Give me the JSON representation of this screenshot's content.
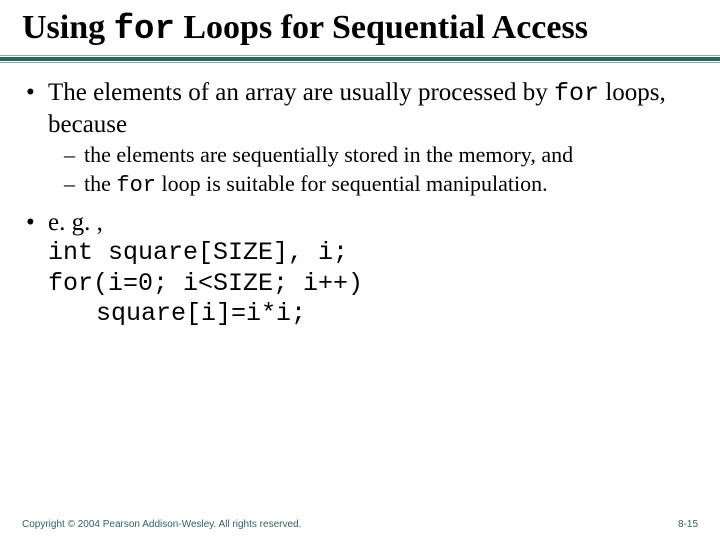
{
  "title": {
    "pre": "Using ",
    "code": "for",
    "post": " Loops for Sequential Access"
  },
  "bullets": {
    "b1_pre": "The elements of an array are usually processed by ",
    "b1_code": "for",
    "b1_post": " loops, because",
    "sub1": "the elements are sequentially stored in the memory, and",
    "sub2_pre": "the ",
    "sub2_code": "for",
    "sub2_post": " loop is suitable for sequential manipulation.",
    "b2": "e. g. ,",
    "code1": "int square[SIZE], i;",
    "code2": "for(i=0; i<SIZE; i++)",
    "code3": "square[i]=i*i;"
  },
  "footer": {
    "copyright": "Copyright © 2004 Pearson Addison-Wesley. All rights reserved.",
    "pagenum": "8-15"
  }
}
